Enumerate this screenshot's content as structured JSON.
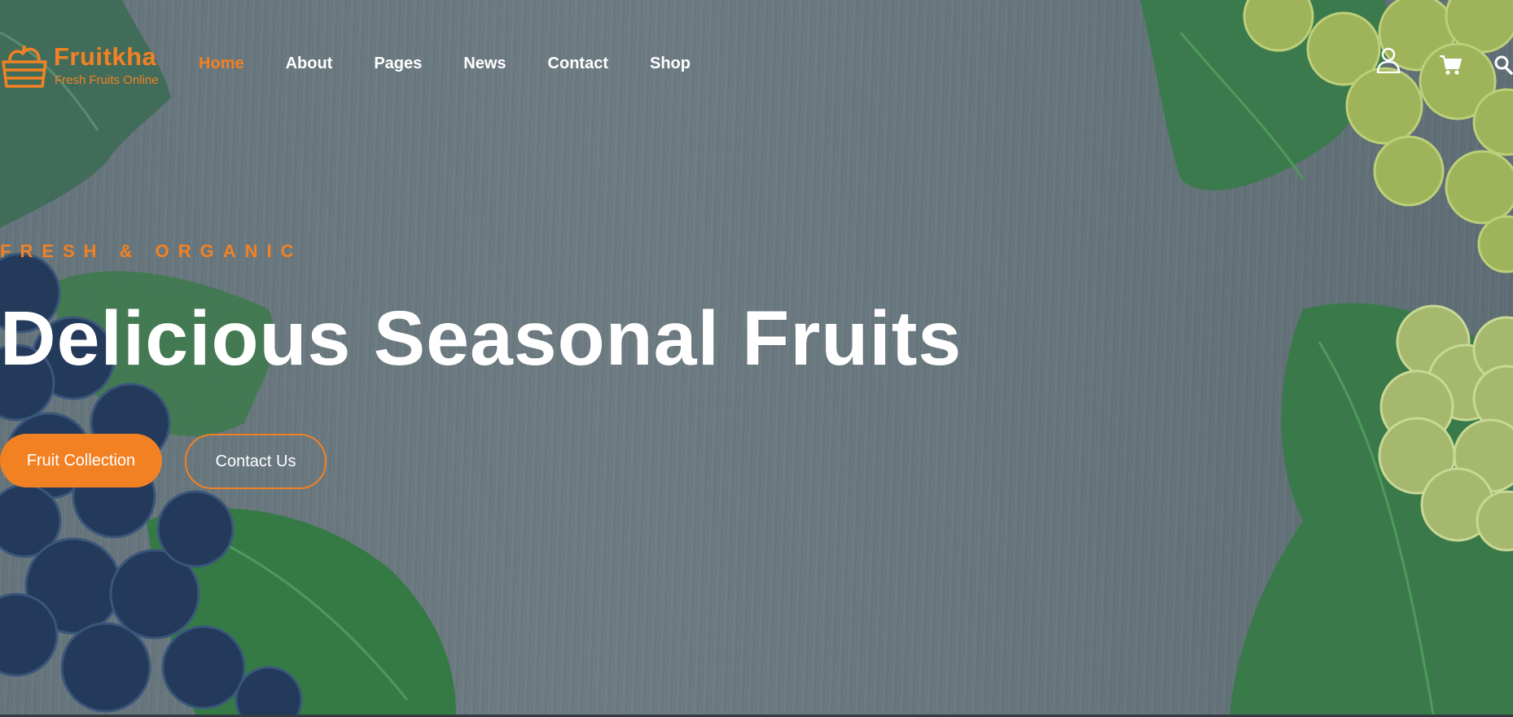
{
  "header": {
    "brand": "Fruitkha",
    "tagline": "Fresh Fruits Online",
    "nav": [
      {
        "label": "Home",
        "active": true
      },
      {
        "label": "About"
      },
      {
        "label": "Pages"
      },
      {
        "label": "News"
      },
      {
        "label": "Contact"
      },
      {
        "label": "Shop"
      }
    ],
    "icons": [
      "user-icon",
      "cart-icon",
      "search-icon"
    ]
  },
  "hero": {
    "subtitle": "FRESH & ORGANIC",
    "headline": "Delicious Seasonal Fruits",
    "primary_button": "Fruit Collection",
    "secondary_button": "Contact Us"
  },
  "colors": {
    "accent": "#f28123",
    "text_light": "#ffffff",
    "overlay": "#66757c"
  }
}
